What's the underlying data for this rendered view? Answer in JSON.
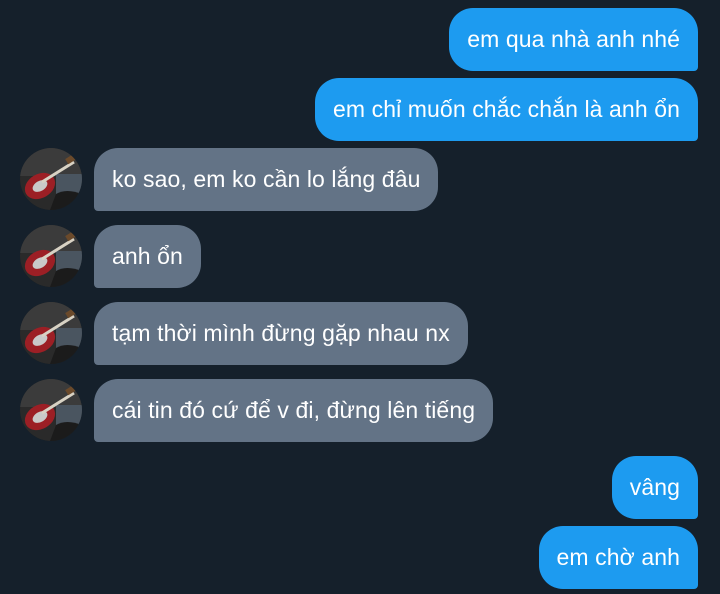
{
  "colors": {
    "background": "#15202b",
    "sent_bubble": "#1d9bf0",
    "received_bubble": "#637386",
    "text": "#ffffff"
  },
  "messages": [
    {
      "side": "sent",
      "text": "em qua nhà anh nhé"
    },
    {
      "side": "sent",
      "text": "em chỉ muốn chắc chắn là anh ổn"
    },
    {
      "side": "received",
      "text": "ko sao, em ko cần lo lắng đâu",
      "avatar": "avatar-guitar-photo"
    },
    {
      "side": "received",
      "text": "anh ổn",
      "avatar": "avatar-guitar-photo"
    },
    {
      "side": "received",
      "text": "tạm thời mình đừng gặp nhau nx",
      "avatar": "avatar-guitar-photo"
    },
    {
      "side": "received",
      "text": "cái tin đó cứ để v đi, đừng lên tiếng",
      "avatar": "avatar-guitar-photo"
    },
    {
      "side": "sent",
      "text": "vâng"
    },
    {
      "side": "sent",
      "text": "em chờ anh"
    }
  ]
}
